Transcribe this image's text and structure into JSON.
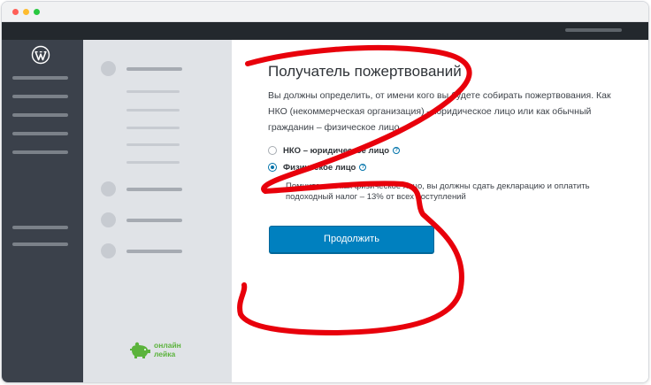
{
  "window": {
    "accent": "#0080bf",
    "scribble_color": "#e8000b"
  },
  "adminbar": {
    "logo_icon": "wordpress-logo-icon"
  },
  "wizard_nav": {
    "brand_line1": "онлайн",
    "brand_line2": "лейка",
    "brand_color": "#5bb33c"
  },
  "content": {
    "heading": "Получатель пожертвований",
    "description": "Вы должны определить, от имени кого вы будете собирать пожертвования. Как НКО (некоммерческая организация) – юридическое лицо или как обычный гражданин – физическое лицо.",
    "options": [
      {
        "label": "НКО – юридическое лицо",
        "checked": false,
        "help_icon": "question-icon"
      },
      {
        "label": "Физическое лицо",
        "checked": true,
        "help_icon": "question-icon"
      }
    ],
    "note": "Помните, что как физическое лицо, вы должны сдать декларацию и оплатить подоходный налог – 13% от всех поступлений",
    "continue_label": "Продолжить"
  }
}
